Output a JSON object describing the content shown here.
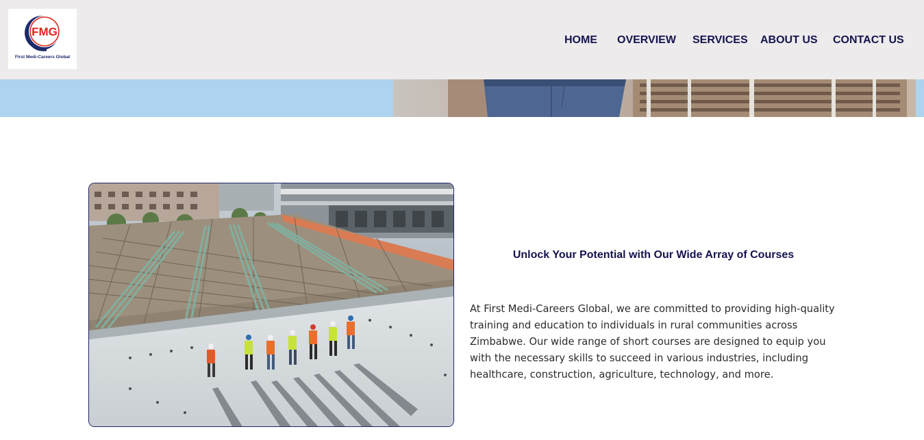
{
  "brand": {
    "logo_letters": "FMG",
    "name": "First Medi-Careers Global",
    "colors": {
      "red": "#e0241c",
      "navy": "#1c2a6b"
    }
  },
  "nav": {
    "items": [
      {
        "label": "HOME"
      },
      {
        "label": "OVERVIEW"
      },
      {
        "label": "SERVICES"
      },
      {
        "label": "ABOUT US"
      },
      {
        "label": "CONTACT US"
      }
    ]
  },
  "section": {
    "title": "Unlock Your Potential with Our Wide Array of Courses",
    "body": "At First Medi-Careers Global, we are committed to providing high-quality training and education to individuals in rural communities across Zimbabwe. Our wide range of short courses are designed to equip you with the necessary skills to succeed in various industries, including healthcare, construction, agriculture, technology, and more."
  },
  "theme": {
    "header_bg": "#edebec",
    "hero_strip": "#aed3ee",
    "heading": "#15134d",
    "text": "#2b2b2b"
  }
}
